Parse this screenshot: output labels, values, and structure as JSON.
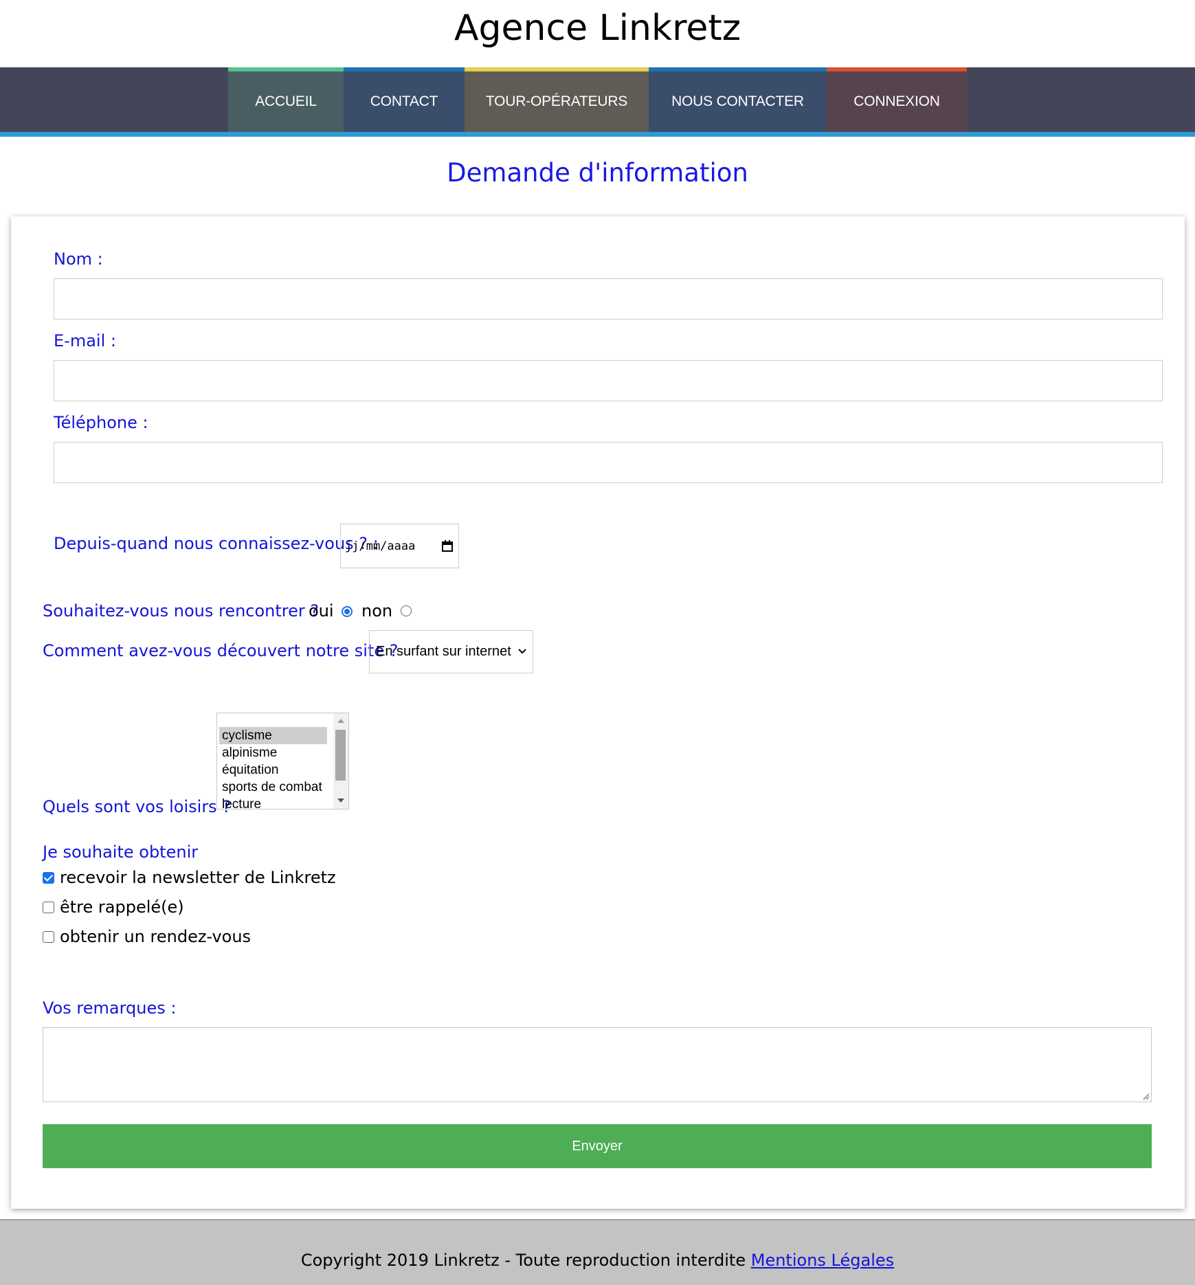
{
  "header": {
    "title": "Agence Linkretz"
  },
  "nav": {
    "items": [
      {
        "label": "ACCUEIL",
        "accent": "#52c48d"
      },
      {
        "label": "CONTACT",
        "accent": "#1f72b5"
      },
      {
        "label": "TOUR-OPÉRATEURS",
        "accent": "#e9cd4c"
      },
      {
        "label": "NOUS CONTACTER",
        "accent": "#1f72b5"
      },
      {
        "label": "CONNEXION",
        "accent": "#d4532e"
      }
    ],
    "bar_color": "#434659",
    "underline_color": "#2f9bd5"
  },
  "page": {
    "heading": "Demande d'information"
  },
  "form": {
    "name_label": "Nom :",
    "name_value": "",
    "email_label": "E-mail :",
    "email_value": "",
    "phone_label": "Téléphone :",
    "phone_value": "",
    "since_label": "Depuis-quand nous connaissez-vous ? :",
    "since_placeholder": "jj/mm/aaaa",
    "meet_label": "Souhaitez-vous nous rencontrer ? :",
    "meet_yes": "oui",
    "meet_no": "non",
    "meet_selected": "oui",
    "discover_label": "Comment avez-vous découvert notre site ?",
    "discover_selected": "En surfant sur internet",
    "hobbies_label": "Quels sont vos loisirs ?",
    "hobbies_options": [
      "cyclisme",
      "alpinisme",
      "équitation",
      "sports de combat",
      "lecture"
    ],
    "hobbies_selected": "cyclisme",
    "wish_label": "Je souhaite obtenir",
    "wish_options": [
      {
        "label": "recevoir la newsletter de Linkretz",
        "checked": true
      },
      {
        "label": "être rappelé(e)",
        "checked": false
      },
      {
        "label": "obtenir un rendez-vous",
        "checked": false
      }
    ],
    "remarks_label": "Vos remarques :",
    "remarks_value": "",
    "submit_label": "Envoyer",
    "submit_color": "#4ead55",
    "label_color": "#1414d9"
  },
  "footer": {
    "text": "Copyright 2019 Linkretz - Toute reproduction interdite",
    "link": "Mentions Légales"
  }
}
